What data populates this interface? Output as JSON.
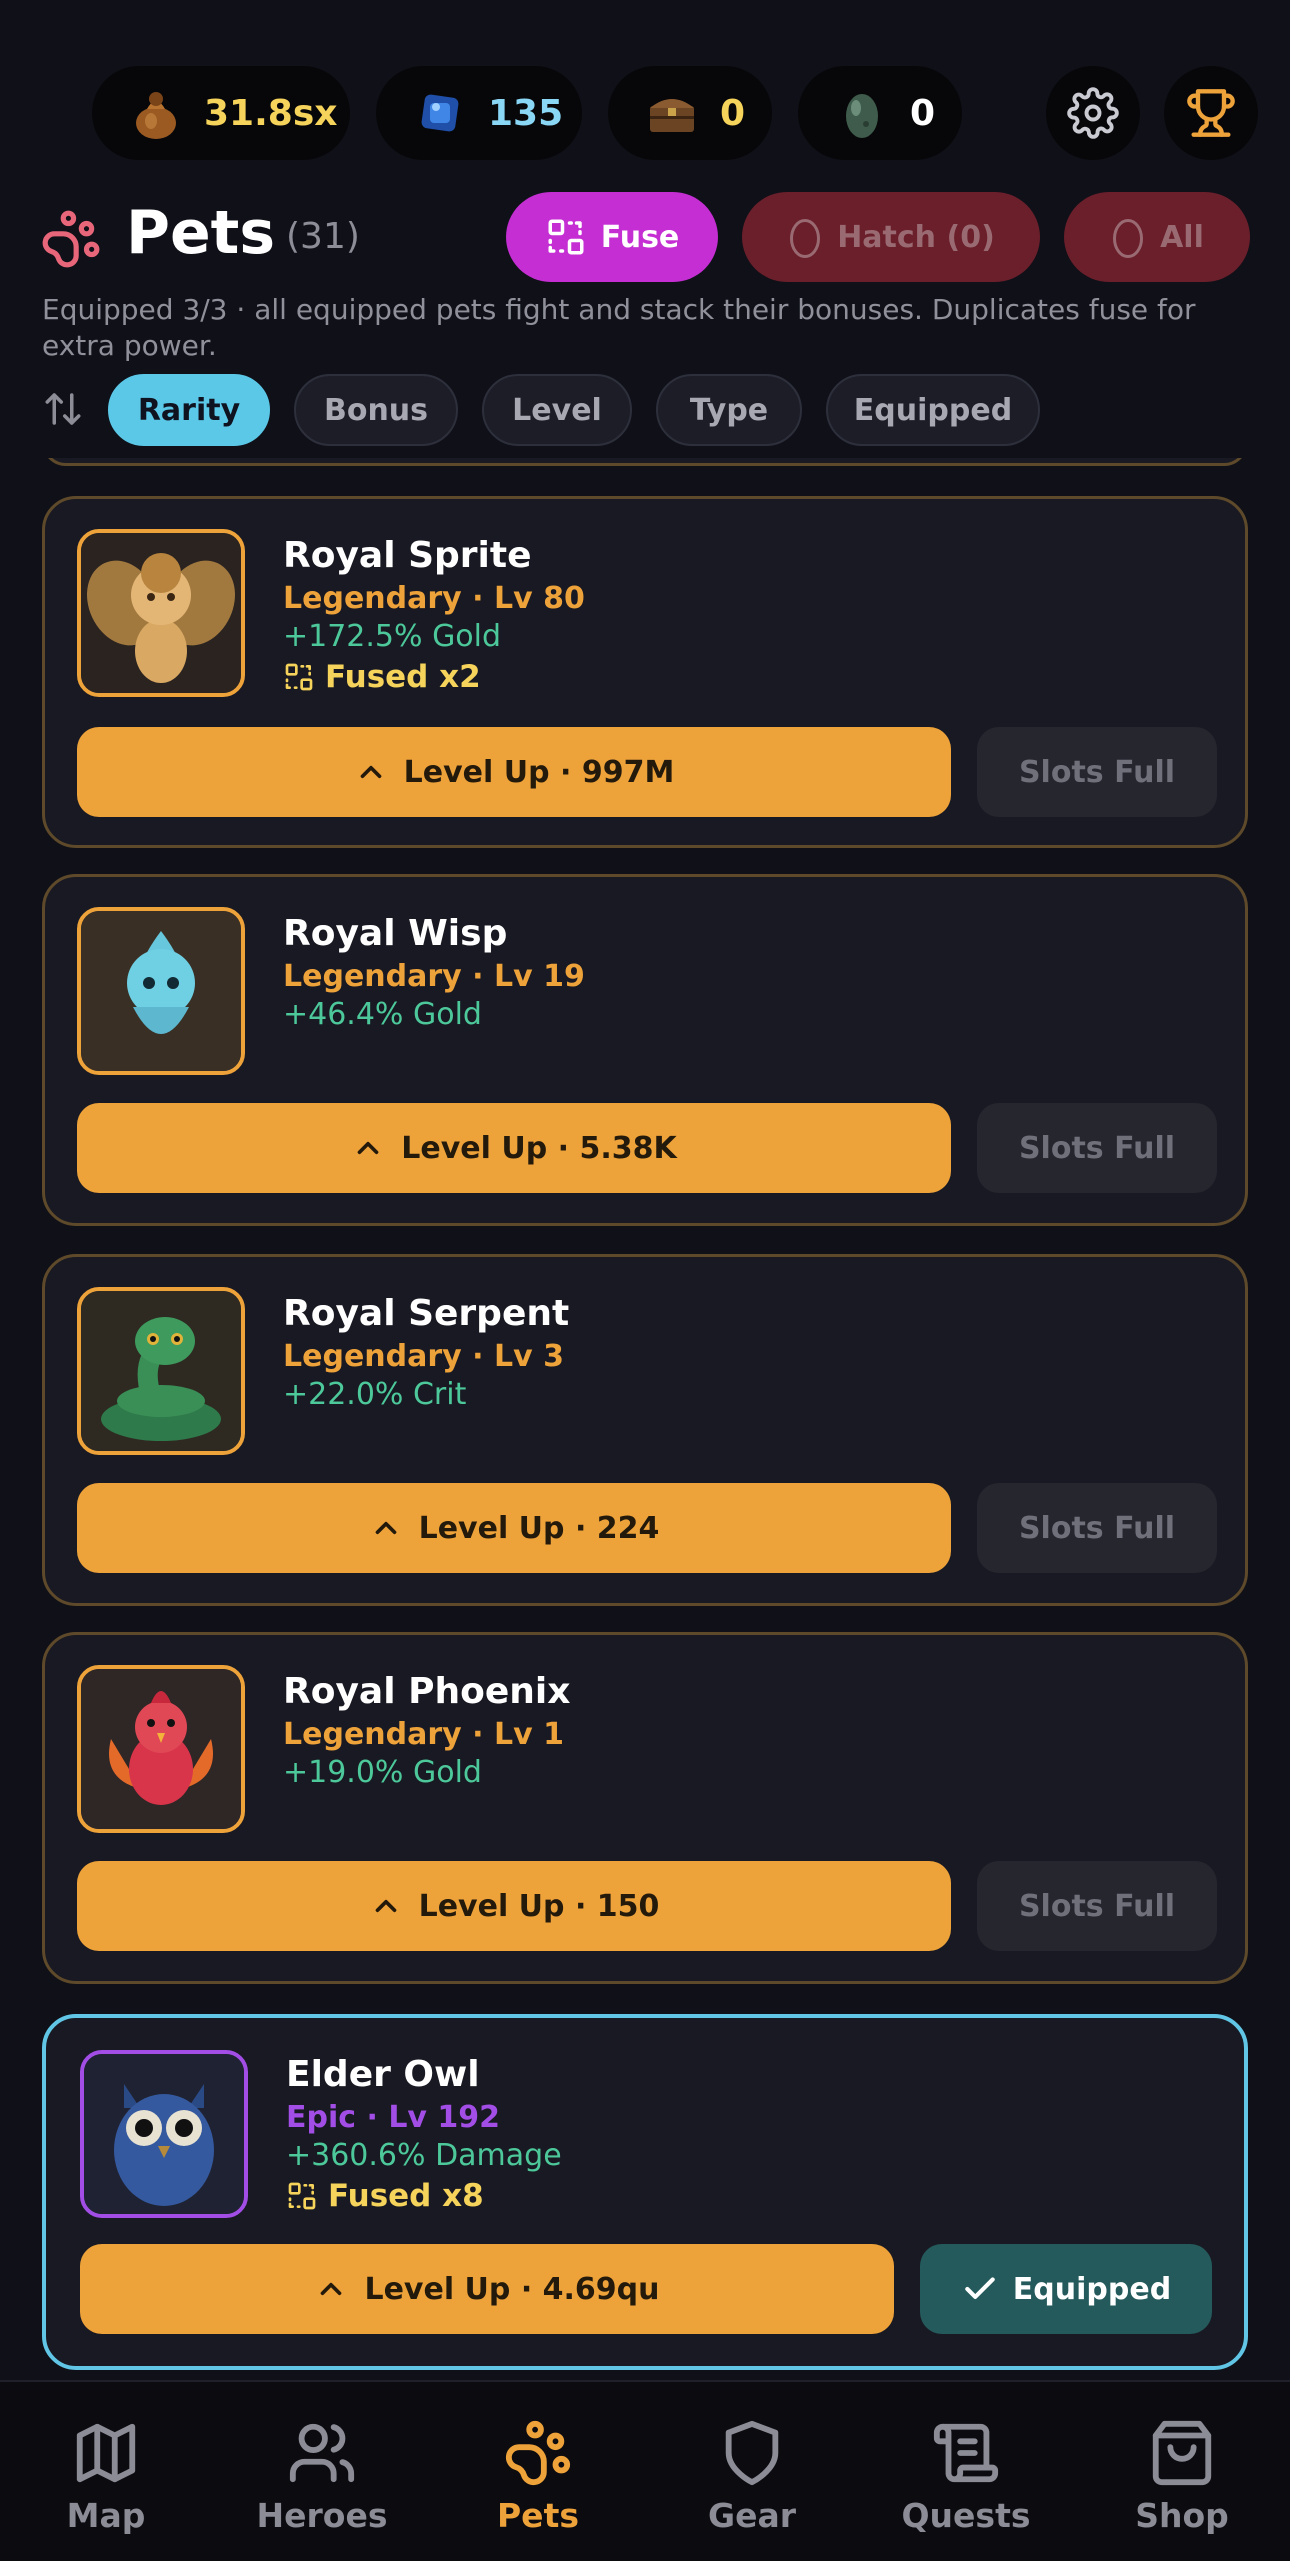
{
  "resources": {
    "gold": "31.8sx",
    "gems": "135",
    "chests": "0",
    "eggs": "0"
  },
  "header": {
    "title": "Pets",
    "count": "(31)",
    "fuse_label": "Fuse",
    "hatch_label": "Hatch (0)",
    "all_label": "All",
    "subtitle": "Equipped 3/3 · all equipped pets fight and stack their bonuses. Duplicates fuse for extra power."
  },
  "sort": {
    "chips": [
      "Rarity",
      "Bonus",
      "Level",
      "Type",
      "Equipped"
    ],
    "active": "Rarity"
  },
  "pets": [
    {
      "name": "Royal Sprite",
      "rarity": "Legendary · Lv 80",
      "bonus": "+172.5% Gold",
      "fused": "Fused x2",
      "level_up": "Level Up · 997M",
      "action": "Slots Full"
    },
    {
      "name": "Royal Wisp",
      "rarity": "Legendary · Lv 19",
      "bonus": "+46.4% Gold",
      "level_up": "Level Up · 5.38K",
      "action": "Slots Full"
    },
    {
      "name": "Royal Serpent",
      "rarity": "Legendary · Lv 3",
      "bonus": "+22.0% Crit",
      "level_up": "Level Up · 224",
      "action": "Slots Full"
    },
    {
      "name": "Royal Phoenix",
      "rarity": "Legendary · Lv 1",
      "bonus": "+19.0% Gold",
      "level_up": "Level Up · 150",
      "action": "Slots Full"
    },
    {
      "name": "Elder Owl",
      "rarity": "Epic · Lv 192",
      "bonus": "+360.6% Damage",
      "fused": "Fused x8",
      "level_up": "Level Up · 4.69qu",
      "action": "Equipped"
    }
  ],
  "nav": {
    "items": [
      "Map",
      "Heroes",
      "Pets",
      "Gear",
      "Quests",
      "Shop"
    ],
    "active": "Pets"
  },
  "colors": {
    "legendary": "#eea23a",
    "epic": "#a24ee6",
    "bonus": "#4dc89a",
    "fuse": "#c42ed2",
    "equipped_border": "#61c6e6"
  }
}
